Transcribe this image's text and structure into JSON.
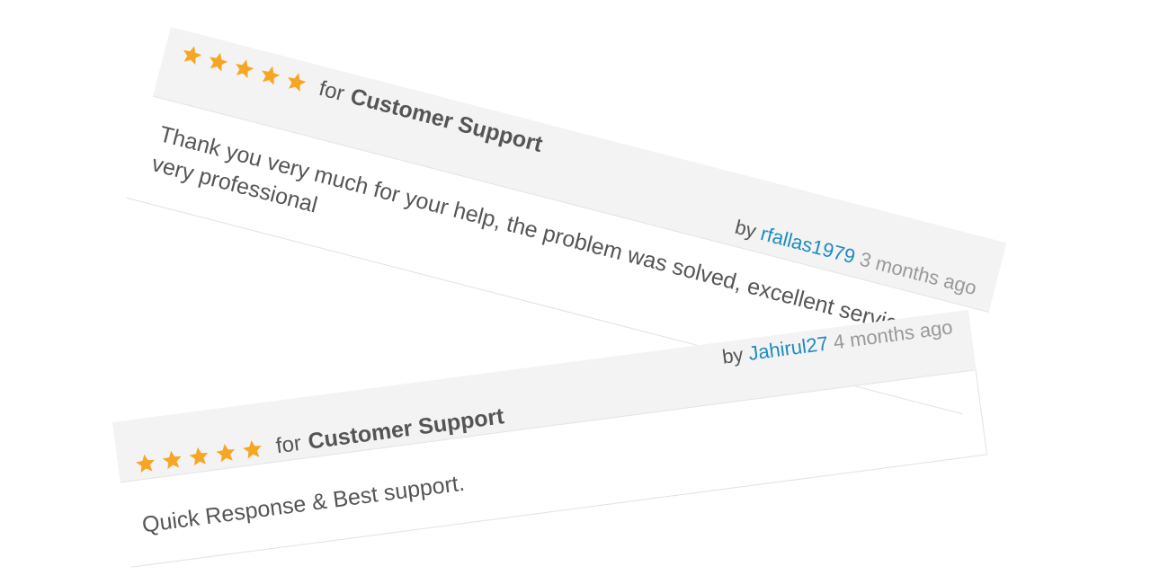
{
  "reviews": [
    {
      "rating_stars": 5,
      "for_label": "for",
      "product": "Customer Support",
      "by_label": "by",
      "author": "rfallas1979",
      "time": "3 months ago",
      "text": "Thank you very much for your help, the problem was solved, excellent service and very professional",
      "star_color": "#f6a623"
    },
    {
      "rating_stars": 5,
      "for_label": "for",
      "product": "Customer Support",
      "by_label": "by",
      "author": "Jahirul27",
      "time": "4 months ago",
      "text": "Quick Response & Best support.",
      "star_color": "#f6a623"
    }
  ],
  "icons": {
    "star": "star-icon"
  }
}
